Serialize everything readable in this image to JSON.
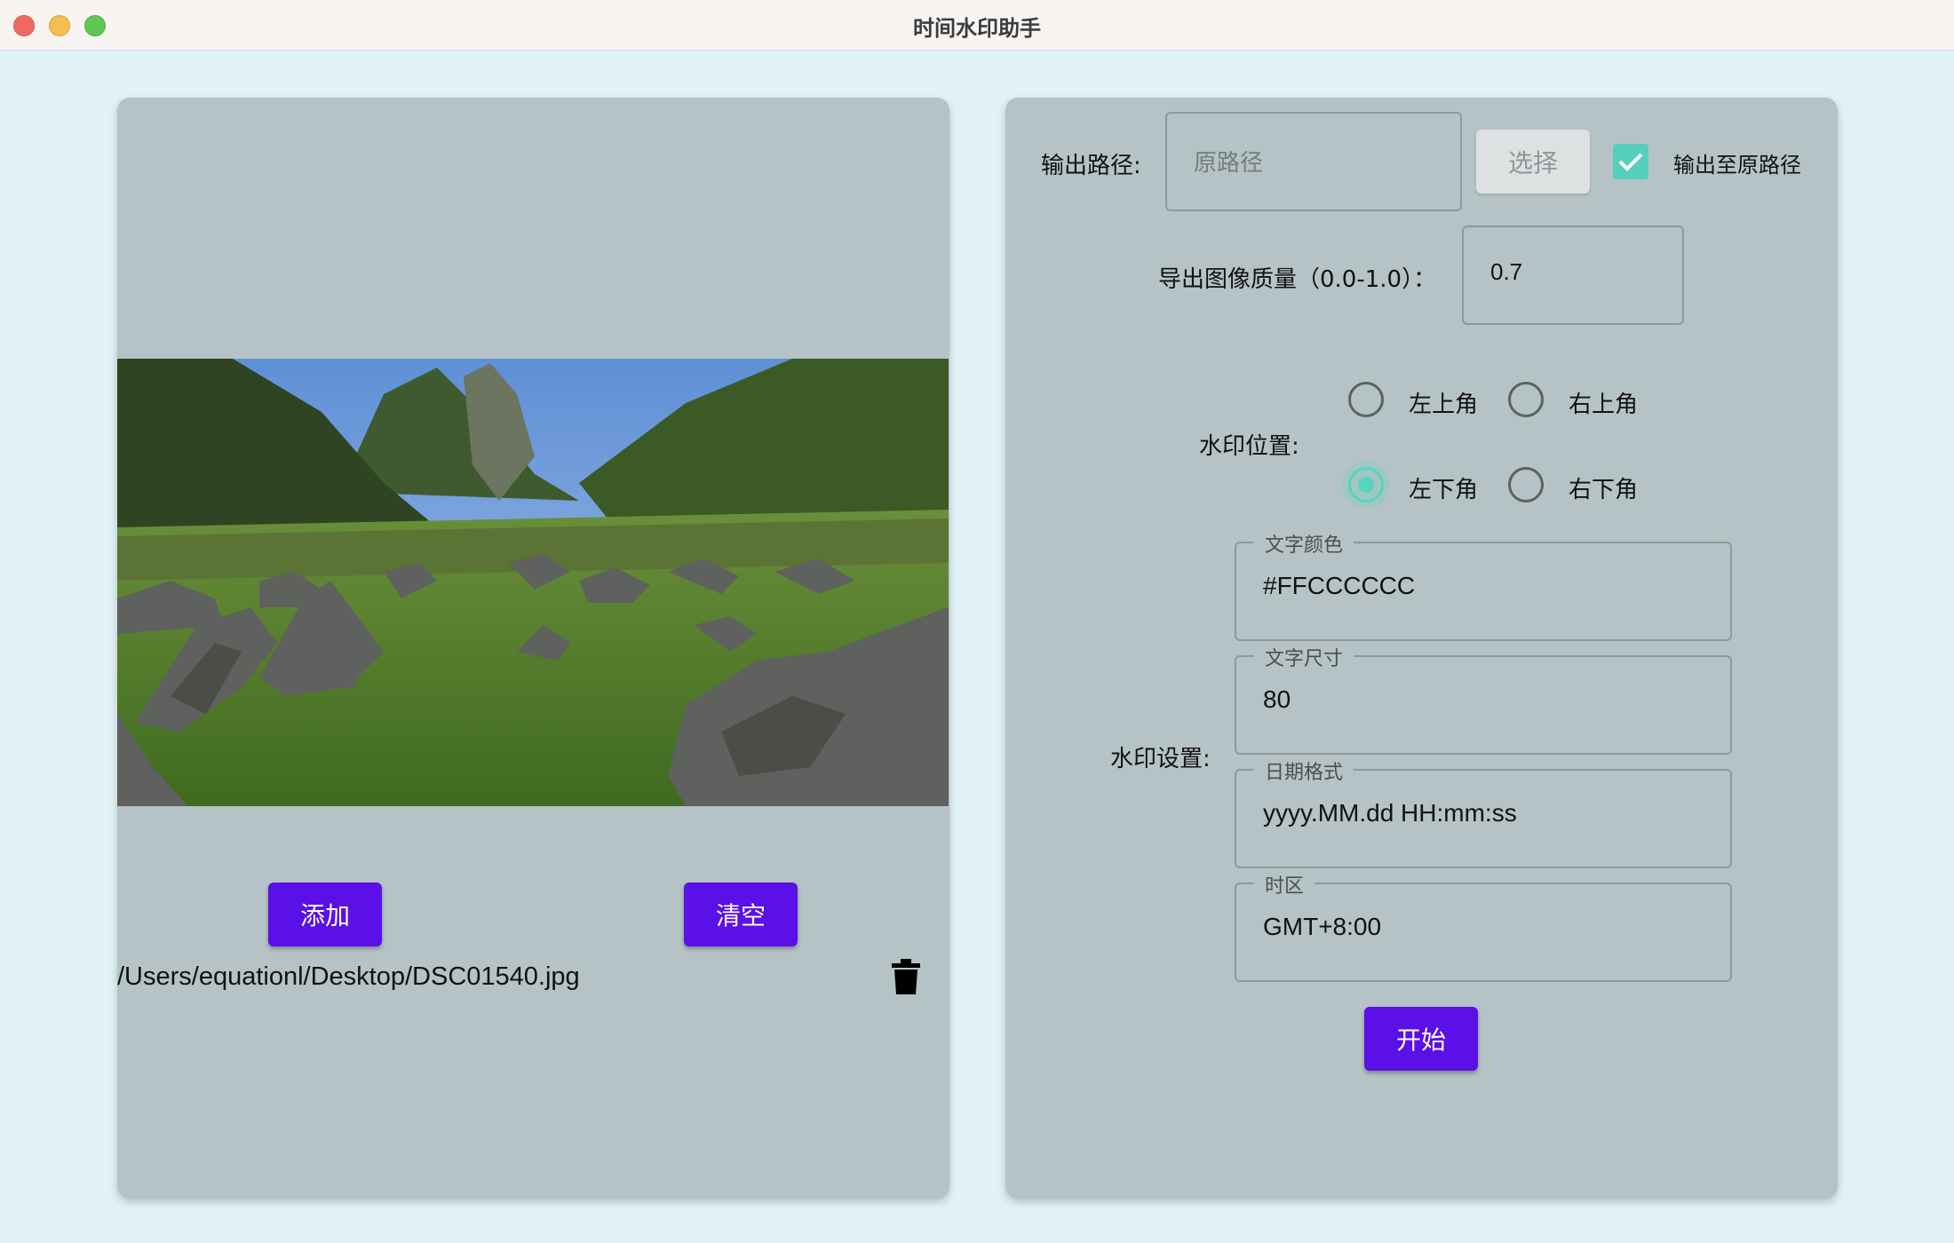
{
  "window": {
    "title": "时间水印助手"
  },
  "left_panel": {
    "add_label": "添加",
    "clear_label": "清空",
    "files": [
      {
        "path": "/Users/equationl/Desktop/DSC01540.jpg"
      }
    ]
  },
  "right_panel": {
    "output_path": {
      "label": "输出路径:",
      "placeholder": "原路径",
      "value": "",
      "choose_label": "选择",
      "checkbox_label": "输出至原路径",
      "checked": true
    },
    "quality": {
      "label": "导出图像质量（0.0-1.0）：",
      "value": "0.7"
    },
    "position": {
      "label": "水印位置:",
      "options": [
        "左上角",
        "右上角",
        "左下角",
        "右下角"
      ],
      "selected": "左下角"
    },
    "settings": {
      "label": "水印设置:",
      "fields": [
        {
          "legend": "文字颜色",
          "value": "#FFCCCCCC"
        },
        {
          "legend": "文字尺寸",
          "value": "80"
        },
        {
          "legend": "日期格式",
          "value": "yyyy.MM.dd HH:mm:ss"
        },
        {
          "legend": "时区",
          "value": "GMT+8:00"
        }
      ]
    },
    "start_label": "开始"
  },
  "colors": {
    "accent": "#5a10e6",
    "check": "#55cfbb",
    "panel": "#b5c3c6",
    "background": "#e2f3f8"
  }
}
